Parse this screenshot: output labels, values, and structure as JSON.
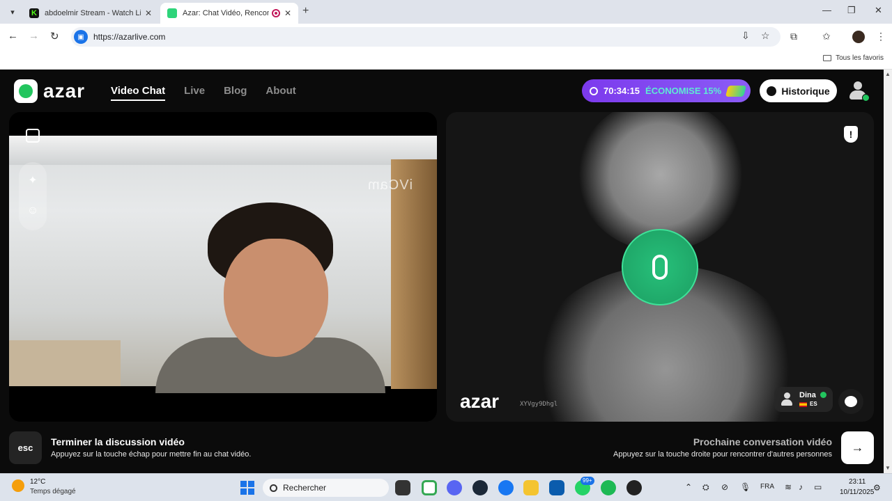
{
  "browser": {
    "tabs": [
      {
        "title": "abdoelmir Stream - Watch Live",
        "active": false
      },
      {
        "title": "Azar: Chat Vidéo, Rencontr",
        "active": true
      }
    ],
    "url": "https://azarlive.com",
    "bookmarks_label": "Tous les favoris"
  },
  "page": {
    "logo_text": "azar",
    "nav": [
      {
        "label": "Video Chat",
        "active": true
      },
      {
        "label": "Live",
        "active": false
      },
      {
        "label": "Blog",
        "active": false
      },
      {
        "label": "About",
        "active": false
      }
    ],
    "promo": {
      "timer": "70:34:15",
      "save_text": "ÉCONOMISE 15%"
    },
    "history_label": "Historique",
    "self_video": {
      "watermark": "iVCam"
    },
    "peer_video": {
      "logo_text": "azar",
      "id": "XYVgy9Dhgl",
      "peer_name": "Dina",
      "peer_lang": "ES"
    },
    "bottom": {
      "esc_key": "esc",
      "end_title": "Terminer la discussion vidéo",
      "end_sub": "Appuyez sur la touche échap pour mettre fin au chat vidéo.",
      "next_title": "Prochaine conversation vidéo",
      "next_sub": "Appuyez sur la touche droite pour rencontrer d'autres personnes"
    }
  },
  "taskbar": {
    "weather_temp": "12°C",
    "weather_desc": "Temps dégagé",
    "search_placeholder": "Rechercher",
    "whatsapp_badge": "99+",
    "language": "FRA",
    "time": "23:11",
    "date": "10/11/2025"
  },
  "colors": {
    "accent_green": "#22c55e",
    "promo_purple": "#7c3aed",
    "promo_save": "#5eead4",
    "mic_green": "#27c07a"
  }
}
